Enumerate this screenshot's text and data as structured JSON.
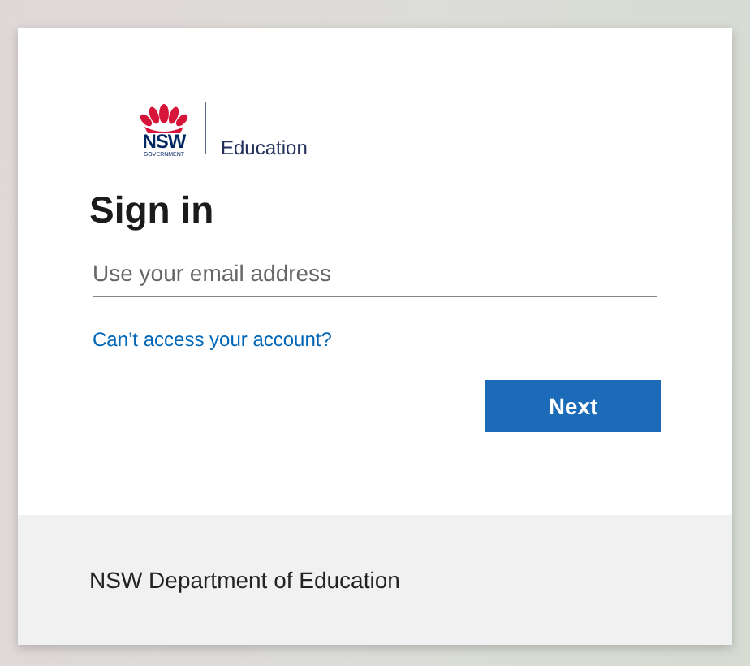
{
  "logo": {
    "wordmark": "NSW",
    "subtitle": "GOVERNMENT",
    "department": "Education"
  },
  "title": "Sign in",
  "email_field": {
    "placeholder": "Use your email address"
  },
  "help_link": "Can’t access your account?",
  "buttons": [
    "Next"
  ],
  "footer": "NSW Department of Education"
}
